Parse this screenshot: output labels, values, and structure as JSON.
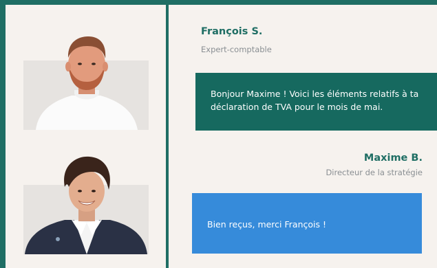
{
  "messages": [
    {
      "sender_name": "François S.",
      "sender_role": "Expert-comptable",
      "text": "Bonjour Maxime ! Voici les éléments relatifs à ta déclaration de TVA pour le mois de mai."
    },
    {
      "sender_name": "Maxime B.",
      "sender_role": "Directeur de la stratégie",
      "text": "Bien reçus, merci François !"
    }
  ],
  "colors": {
    "brand_green": "#1f6e64",
    "bubble_green": "#16695f",
    "bubble_blue": "#368bda",
    "panel_bg": "#f6f2ee",
    "photo_bg": "#e6e3e0"
  }
}
